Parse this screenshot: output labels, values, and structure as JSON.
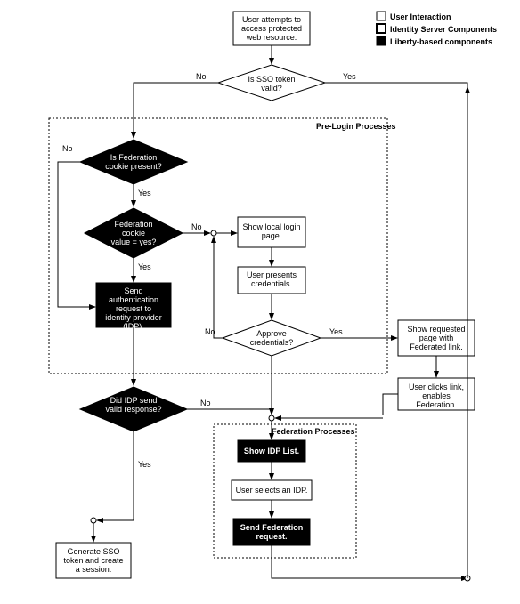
{
  "legend": {
    "item1": "User Interaction",
    "item2": "Identity Server Components",
    "item3": "Liberty-based components"
  },
  "groups": {
    "prelogin": "Pre-Login Processes",
    "federation": "Federation Processes"
  },
  "nodes": {
    "start": "User attempts to access protected web resource.",
    "sso_valid": "Is SSO token valid?",
    "fed_cookie_present": "Is Federation cookie present?",
    "fed_cookie_yes": "Federation cookie value = yes?",
    "send_auth": "Send authentication request to identity provider (IDP).",
    "show_login": "Show local login page.",
    "user_presents": "User presents credentials.",
    "approve": "Approve credentials?",
    "show_requested": "Show requested page with Federated link.",
    "user_clicks": "User clicks link, enables Federation.",
    "did_idp": "Did IDP send valid response?",
    "show_idp_list": "Show IDP List.",
    "user_selects": "User selects an IDP.",
    "send_fed_req": "Send Federation request.",
    "generate_sso": "Generate SSO token and create a session."
  },
  "labels": {
    "yes": "Yes",
    "no": "No"
  }
}
